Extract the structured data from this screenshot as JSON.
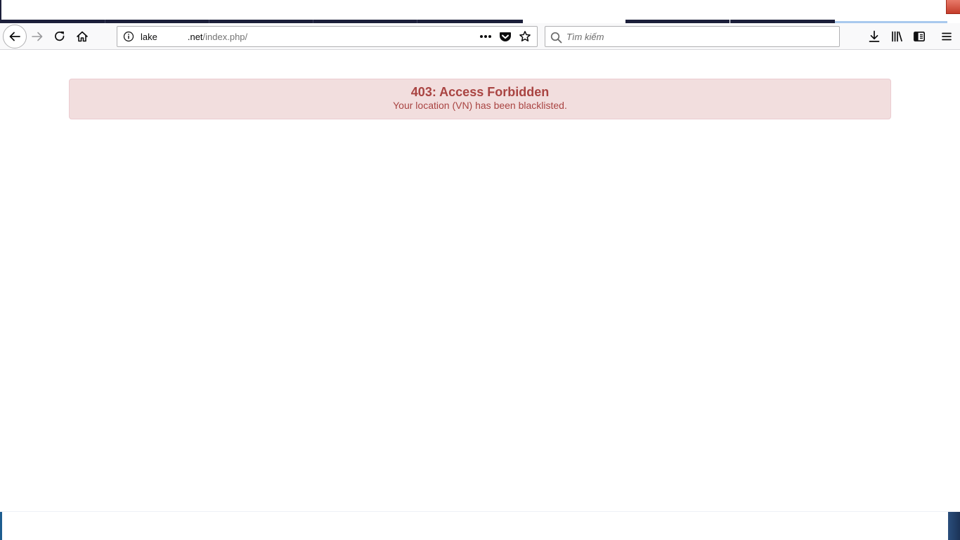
{
  "browser": {
    "urlbar": {
      "host_prefix": "lake",
      "host_suffix": ".net",
      "path": "/index.php/"
    },
    "searchbar": {
      "placeholder": "Tìm kiếm"
    },
    "icons": {
      "back": "back-arrow-icon",
      "forward": "forward-arrow-icon",
      "reload": "reload-icon",
      "home": "home-icon",
      "site_info": "info-icon",
      "page_actions": "more-icon",
      "pocket": "pocket-icon",
      "bookmark": "star-icon",
      "search": "search-icon",
      "downloads": "download-icon",
      "library": "library-icon",
      "sidebar": "sidebar-icon",
      "menu": "hamburger-menu-icon"
    }
  },
  "page": {
    "alert": {
      "title": "403: Access Forbidden",
      "message": "Your location (VN) has been blacklisted."
    }
  },
  "colors": {
    "alert_background": "#f2dede",
    "alert_border": "#ebccd1",
    "alert_text": "#a94442",
    "tab_strip_dark": "#1c1f3a"
  }
}
